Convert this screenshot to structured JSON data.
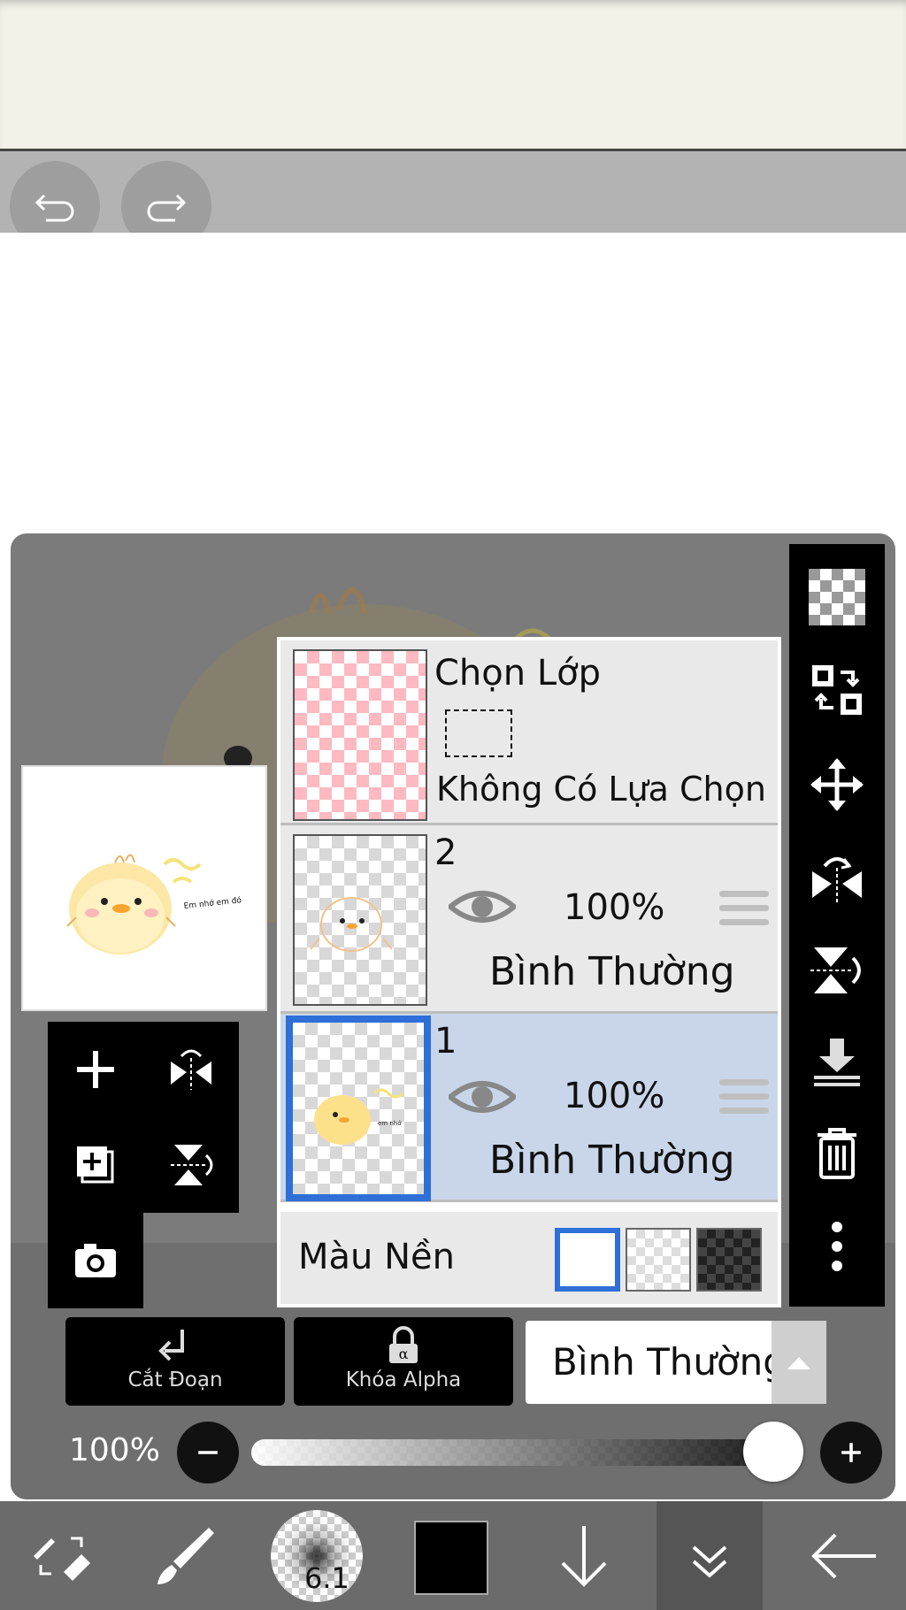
{
  "history": {
    "undo_icon": "undo-arrow-icon",
    "redo_icon": "redo-arrow-icon"
  },
  "layers_panel": {
    "selection_layer": {
      "title": "Chọn Lớp",
      "subtitle": "Không Có Lựa Chọn"
    },
    "layers": [
      {
        "name": "2",
        "opacity": "100%",
        "blend": "Bình Thường",
        "selected": false
      },
      {
        "name": "1",
        "opacity": "100%",
        "blend": "Bình Thường",
        "selected": true
      }
    ],
    "background": {
      "label": "Màu Nền",
      "options": [
        "white",
        "transparent",
        "dark-checker"
      ],
      "selected": "white"
    },
    "preview_caption": "Em nhớ em đó"
  },
  "actions": {
    "clipping_label": "Cắt Đoạn",
    "alpha_lock_label": "Khóa Alpha",
    "blend_mode": "Bình Thường"
  },
  "opacity": {
    "label": "100%",
    "value": 1.0
  },
  "toolbar": {
    "brush_size": "6.1",
    "color": "#000000"
  },
  "colors": {
    "accent": "#2e6fd8",
    "selected_row": "#c9d6ea",
    "panel_bg": "#7b7b7b"
  }
}
